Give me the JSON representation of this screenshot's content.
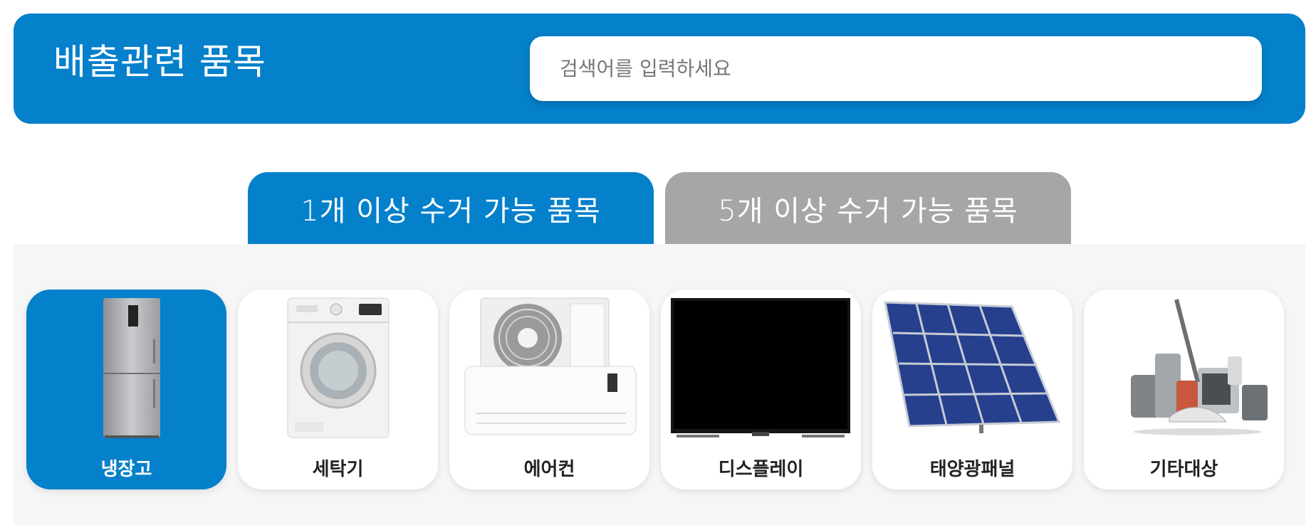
{
  "header": {
    "title": "배출관련 품목",
    "search_placeholder": "검색어를 입력하세요"
  },
  "tabs": [
    {
      "label": "1개 이상 수거 가능 품목",
      "active": true
    },
    {
      "label": "5개 이상 수거 가능 품목",
      "active": false
    }
  ],
  "items": [
    {
      "label": "냉장고",
      "icon": "refrigerator-icon",
      "selected": true
    },
    {
      "label": "세탁기",
      "icon": "washing-machine-icon",
      "selected": false
    },
    {
      "label": "에어컨",
      "icon": "air-conditioner-icon",
      "selected": false
    },
    {
      "label": "디스플레이",
      "icon": "display-icon",
      "selected": false
    },
    {
      "label": "태양광패널",
      "icon": "solar-panel-icon",
      "selected": false
    },
    {
      "label": "기타대상",
      "icon": "appliances-icon",
      "selected": false
    }
  ],
  "colors": {
    "brand_blue": "#0580cb",
    "inactive_tab": "#a6a6a6",
    "panel_bg": "#f6f6f6"
  }
}
